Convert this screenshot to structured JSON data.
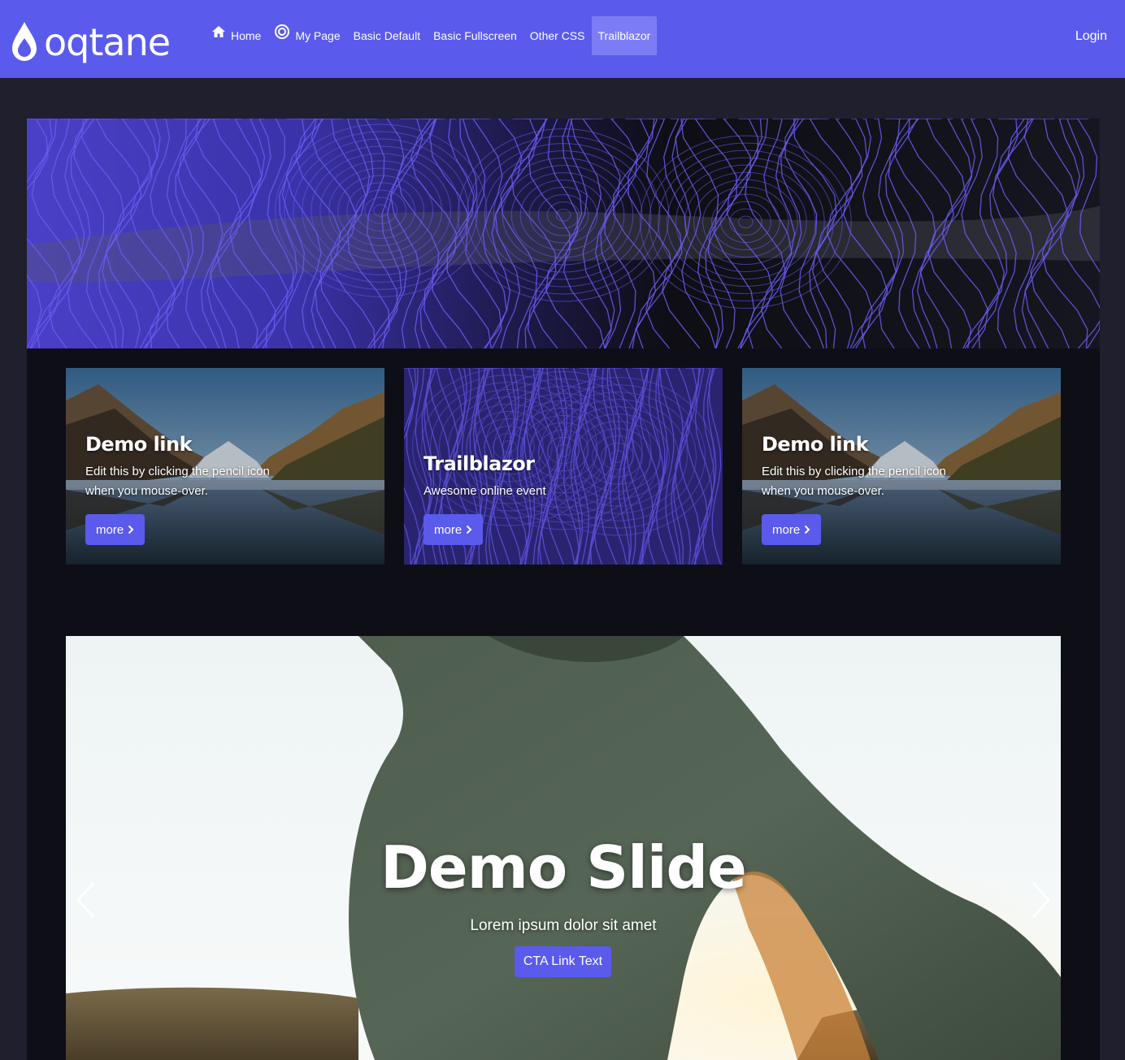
{
  "brand": {
    "name": "oqtane",
    "accent": "#5a5bec",
    "active_bg": "#7c7df5"
  },
  "nav": {
    "items": [
      {
        "label": "Home",
        "icon": "home-icon"
      },
      {
        "label": "My Page",
        "icon": "target-icon"
      },
      {
        "label": "Basic Default"
      },
      {
        "label": "Basic Fullscreen"
      },
      {
        "label": "Other CSS"
      },
      {
        "label": "Trailblazor",
        "active": true
      }
    ],
    "login_label": "Login"
  },
  "cards": [
    {
      "title": "Demo link",
      "text": "Edit this by clicking the pencil icon when you mouse-over.",
      "button": "more",
      "image": "mountain-lake"
    },
    {
      "title": "Trailblazor",
      "text": "Awesome online event",
      "button": "more",
      "image": "contour-lines"
    },
    {
      "title": "Demo link",
      "text": "Edit this by clicking the pencil icon when you mouse-over.",
      "button": "more",
      "image": "mountain-lake"
    }
  ],
  "slide": {
    "title": "Demo Slide",
    "subtitle": "Lorem ipsum dolor sit amet",
    "cta": "CTA Link Text",
    "prev_icon": "chevron-left-icon",
    "next_icon": "chevron-right-icon"
  }
}
